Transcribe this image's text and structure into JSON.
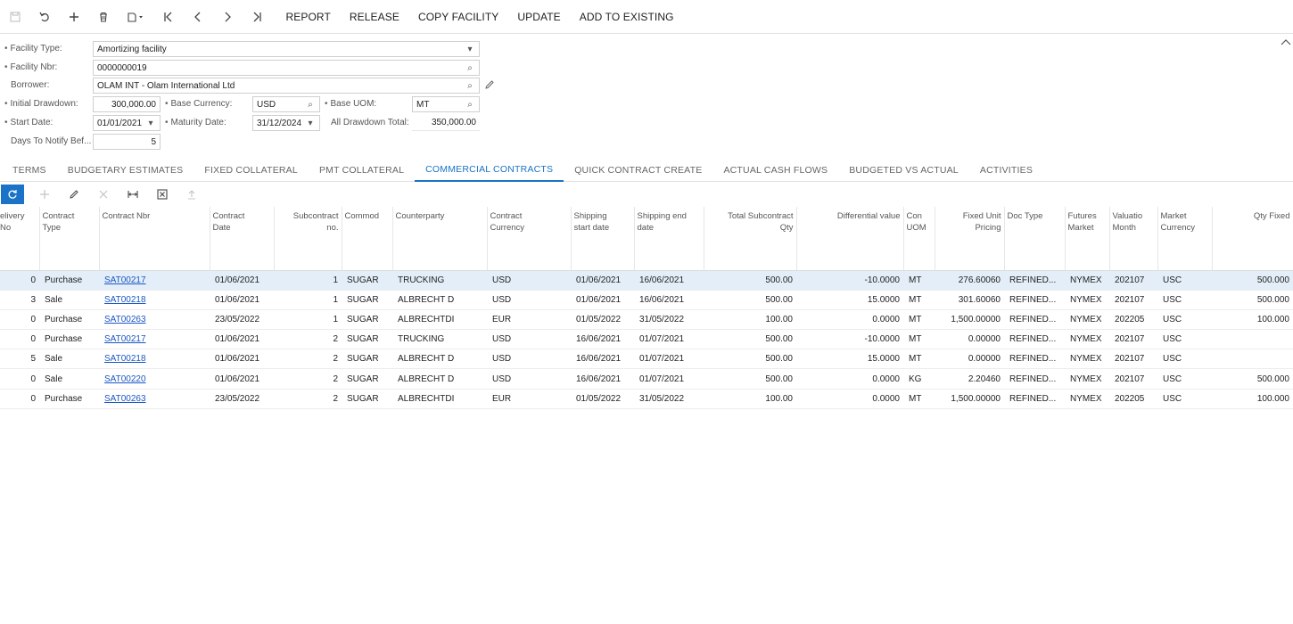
{
  "toolbar": {
    "actions": [
      "REPORT",
      "RELEASE",
      "COPY FACILITY",
      "UPDATE",
      "ADD TO EXISTING"
    ]
  },
  "form": {
    "facility_type_label": "Facility Type:",
    "facility_type": "Amortizing facility",
    "facility_nbr_label": "Facility Nbr:",
    "facility_nbr": "0000000019",
    "borrower_label": "Borrower:",
    "borrower": "OLAM INT - Olam International Ltd",
    "initial_drawdown_label": "Initial Drawdown:",
    "initial_drawdown": "300,000.00",
    "base_currency_label": "Base Currency:",
    "base_currency": "USD",
    "base_uom_label": "Base UOM:",
    "base_uom": "MT",
    "start_date_label": "Start Date:",
    "start_date": "01/01/2021",
    "maturity_date_label": "Maturity Date:",
    "maturity_date": "31/12/2024",
    "all_drawdown_total_label": "All Drawdown Total:",
    "all_drawdown_total": "350,000.00",
    "days_to_notify_label": "Days To Notify Bef...",
    "days_to_notify": "5"
  },
  "tabs": [
    "TERMS",
    "BUDGETARY ESTIMATES",
    "FIXED COLLATERAL",
    "PMT COLLATERAL",
    "COMMERCIAL CONTRACTS",
    "QUICK CONTRACT CREATE",
    "ACTUAL CASH FLOWS",
    "BUDGETED VS ACTUAL",
    "ACTIVITIES"
  ],
  "active_tab": "COMMERCIAL CONTRACTS",
  "table": {
    "columns": [
      "elivery No",
      "Contract\nType",
      "Contract Nbr",
      "Contract\nDate",
      "Subcontract\nno.",
      "Commod",
      "Counterparty",
      "Contract\nCurrency",
      "Shipping\nstart date",
      "Shipping end\ndate",
      "Total Subcontract\nQty",
      "Differential value",
      "Con\nUOM",
      "Fixed Unit\nPricing",
      "Doc Type",
      "Futures\nMarket",
      "Valuatio\nMonth",
      "Market\nCurrency",
      "Qty Fixed"
    ],
    "rows": [
      [
        "0",
        "Purchase",
        "SAT00217",
        "01/06/2021",
        "1",
        "SUGAR",
        "TRUCKING",
        "USD",
        "01/06/2021",
        "16/06/2021",
        "500.00",
        "-10.0000",
        "MT",
        "276.60060",
        "REFINED...",
        "NYMEX",
        "202107",
        "USC",
        "500.000"
      ],
      [
        "3",
        "Sale",
        "SAT00218",
        "01/06/2021",
        "1",
        "SUGAR",
        "ALBRECHT D",
        "USD",
        "01/06/2021",
        "16/06/2021",
        "500.00",
        "15.0000",
        "MT",
        "301.60060",
        "REFINED...",
        "NYMEX",
        "202107",
        "USC",
        "500.000"
      ],
      [
        "0",
        "Purchase",
        "SAT00263",
        "23/05/2022",
        "1",
        "SUGAR",
        "ALBRECHTDI",
        "EUR",
        "01/05/2022",
        "31/05/2022",
        "100.00",
        "0.0000",
        "MT",
        "1,500.00000",
        "REFINED...",
        "NYMEX",
        "202205",
        "USC",
        "100.000"
      ],
      [
        "0",
        "Purchase",
        "SAT00217",
        "01/06/2021",
        "2",
        "SUGAR",
        "TRUCKING",
        "USD",
        "16/06/2021",
        "01/07/2021",
        "500.00",
        "-10.0000",
        "MT",
        "0.00000",
        "REFINED...",
        "NYMEX",
        "202107",
        "USC",
        ""
      ],
      [
        "5",
        "Sale",
        "SAT00218",
        "01/06/2021",
        "2",
        "SUGAR",
        "ALBRECHT D",
        "USD",
        "16/06/2021",
        "01/07/2021",
        "500.00",
        "15.0000",
        "MT",
        "0.00000",
        "REFINED...",
        "NYMEX",
        "202107",
        "USC",
        ""
      ],
      [
        "0",
        "Sale",
        "SAT00220",
        "01/06/2021",
        "2",
        "SUGAR",
        "ALBRECHT D",
        "USD",
        "16/06/2021",
        "01/07/2021",
        "500.00",
        "0.0000",
        "KG",
        "2.20460",
        "REFINED...",
        "NYMEX",
        "202107",
        "USC",
        "500.000"
      ],
      [
        "0",
        "Purchase",
        "SAT00263",
        "23/05/2022",
        "2",
        "SUGAR",
        "ALBRECHTDI",
        "EUR",
        "01/05/2022",
        "31/05/2022",
        "100.00",
        "0.0000",
        "MT",
        "1,500.00000",
        "REFINED...",
        "NYMEX",
        "202205",
        "USC",
        "100.000"
      ]
    ]
  }
}
